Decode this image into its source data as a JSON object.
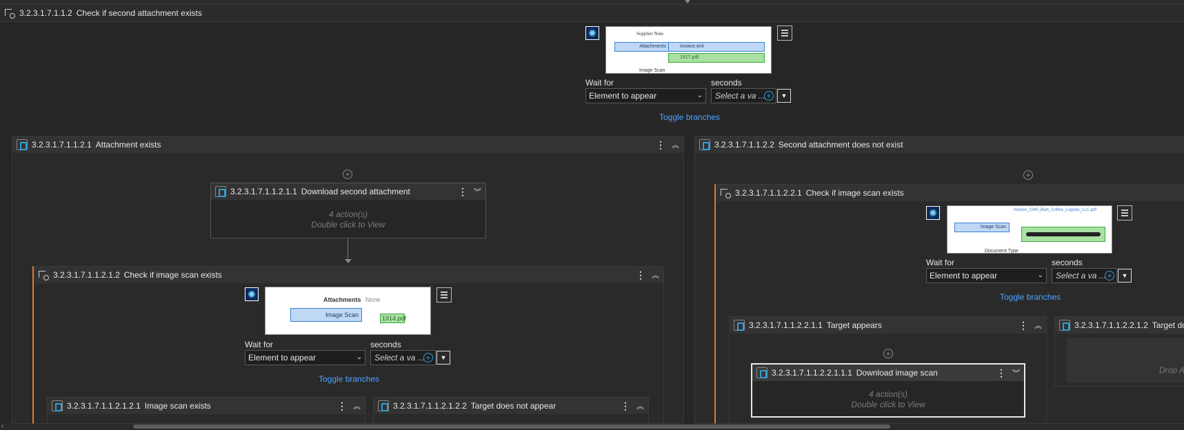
{
  "top_header": {
    "num": "3.2.3.1.7.1.1.2",
    "title": "Check if second attachment exists"
  },
  "top_step": {
    "thumb_text": {
      "supplier_note": "Supplier Note",
      "attachments": "Attachments",
      "invoice": "invoice.xml",
      "pdf": "1917.pdf",
      "image_scan": "Image Scan"
    },
    "wait_for_label": "Wait for",
    "wait_for_value": "Element to appear",
    "seconds_label": "seconds",
    "seconds_placeholder": "Select a va ...",
    "toggle": "Toggle branches"
  },
  "left_branch": {
    "num": "3.2.3.1.7.1.1.2.1",
    "title": "Attachment exists"
  },
  "right_branch": {
    "num": "3.2.3.1.7.1.1.2.2",
    "title": "Second attachment does not exist"
  },
  "download_second": {
    "num": "3.2.3.1.7.1.1.2.1.1",
    "title": "Download second attachment",
    "actions": "4 action(s)",
    "hint": "Double click to View"
  },
  "check_image_left": {
    "num": "3.2.3.1.7.1.1.2.1.2",
    "title": "Check if image scan exists",
    "thumb_text": {
      "attachments": "Attachments",
      "none": "None",
      "image_scan": "Image Scan",
      "pdf": "1914.pdf"
    },
    "wait_for_label": "Wait for",
    "wait_for_value": "Element to appear",
    "seconds_label": "seconds",
    "seconds_placeholder": "Select a va ...",
    "toggle": "Toggle branches"
  },
  "image_scan_exists": {
    "num": "3.2.3.1.7.1.1.2.1.2.1",
    "title": "Image scan exists"
  },
  "target_not_appear_left": {
    "num": "3.2.3.1.7.1.1.2.1.2.2",
    "title": "Target does not appear"
  },
  "check_image_right": {
    "num": "3.2.3.1.7.1.1.2.2.1",
    "title": "Check if image scan exists",
    "thumb_text": {
      "file": "Invoice_2340_Blah_Coffee_Logistic_LLC.pdf",
      "image_scan": "Image Scan",
      "doc_type": "Document Type"
    },
    "wait_for_label": "Wait for",
    "wait_for_value": "Element to appear",
    "seconds_label": "seconds",
    "seconds_placeholder": "Select a va ...",
    "toggle": "Toggle branches"
  },
  "target_appears": {
    "num": "3.2.3.1.7.1.1.2.2.1.1",
    "title": "Target appears"
  },
  "target_does_right": {
    "num": "3.2.3.1.7.1.1.2.2.1.2",
    "title": "Target do",
    "drop": "Drop A"
  },
  "download_image_scan": {
    "num": "3.2.3.1.7.1.1.2.2.1.1.1",
    "title": "Download image scan",
    "actions": "4 action(s)",
    "hint": "Double click to View"
  },
  "colors": {
    "accent": "#e07a3a",
    "link": "#4da3ff",
    "selection": "#2f9fd8"
  }
}
